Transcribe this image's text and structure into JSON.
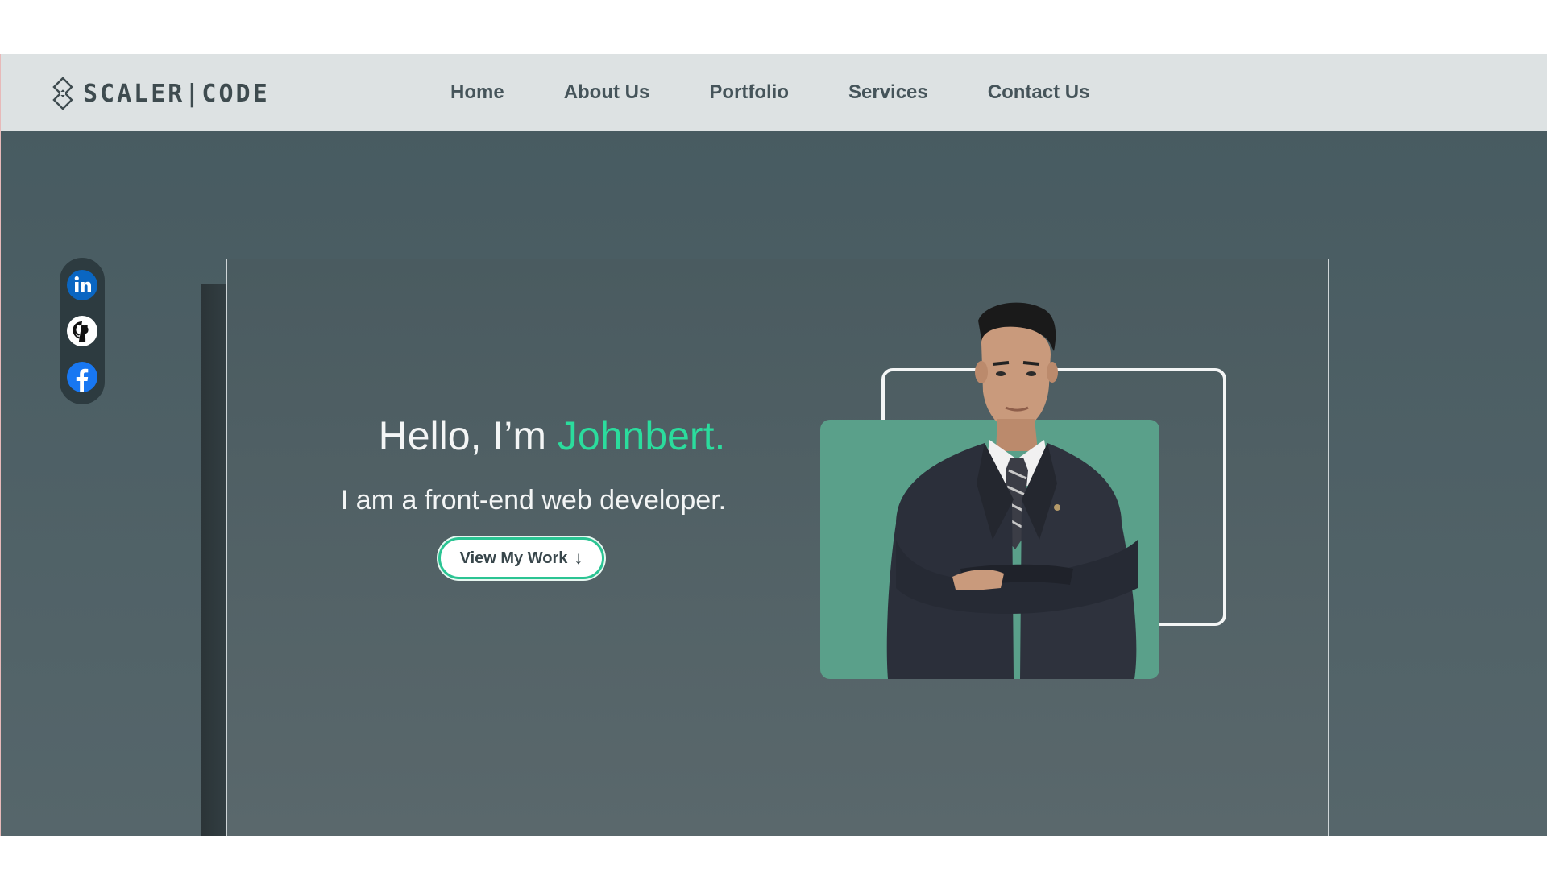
{
  "logo": {
    "text": "SCALER|CODE"
  },
  "nav": {
    "items": [
      {
        "label": "Home"
      },
      {
        "label": "About Us"
      },
      {
        "label": "Portfolio"
      },
      {
        "label": "Services"
      },
      {
        "label": "Contact Us"
      }
    ]
  },
  "social": {
    "items": [
      {
        "icon": "linkedin-icon",
        "color": "#0a66c2"
      },
      {
        "icon": "github-icon",
        "color": "#ffffff"
      },
      {
        "icon": "facebook-icon",
        "color": "#1877f2"
      }
    ]
  },
  "hero": {
    "greeting_prefix": "Hello, I’m ",
    "name": "Johnbert.",
    "subtitle": "I am a front-end web developer.",
    "cta_label": "View My Work",
    "cta_arrow": "↓"
  },
  "colors": {
    "accent": "#2bdc9d",
    "nav_bg": "#dde2e3",
    "page_bg": "#4a5b60",
    "photo_bg": "#5aa08a"
  }
}
